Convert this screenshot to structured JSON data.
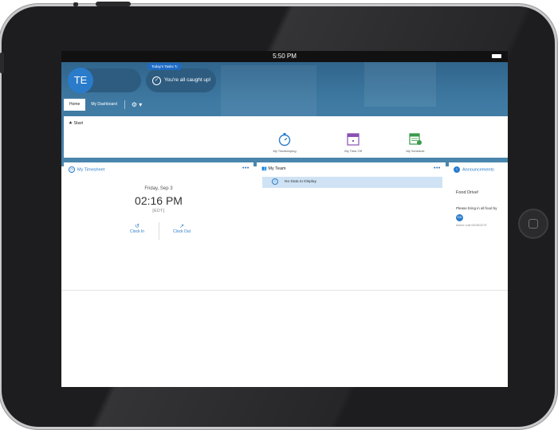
{
  "status_bar": {
    "time": "5:50 PM"
  },
  "header": {
    "avatar_initials": "TE",
    "todays_tasks_label": "Today's Tasks",
    "caught_up_text": "You're all caught up!"
  },
  "tabs": [
    {
      "label": "Home",
      "active": true
    },
    {
      "label": "My Dashboard",
      "active": false
    }
  ],
  "start": {
    "title": "Start",
    "quick_links": [
      {
        "label": "My Timekeeping",
        "icon": "stopwatch-icon"
      },
      {
        "label": "My Time Off",
        "icon": "calendar-icon"
      },
      {
        "label": "My Schedule",
        "icon": "schedule-icon"
      }
    ]
  },
  "timesheet": {
    "title": "My Timesheet",
    "date": "Friday, Sep 3",
    "time": "02:16 PM",
    "timezone": "[EDT]",
    "clock_in_label": "Clock In",
    "clock_out_label": "Clock Out"
  },
  "team": {
    "title": "My Team",
    "empty_text": "No Data to Display"
  },
  "announcements": {
    "title": "Announcements",
    "item_title": "Food Drive!",
    "item_body": "Please bring in all food by",
    "author_initials": "KW",
    "active_until": "Active until 06/05/2079"
  },
  "colors": {
    "accent": "#2a7ccb",
    "header_blue": "#3f7aa3",
    "schedule_green": "#3a9a4a",
    "timeoff_purple": "#8a4fb3"
  }
}
